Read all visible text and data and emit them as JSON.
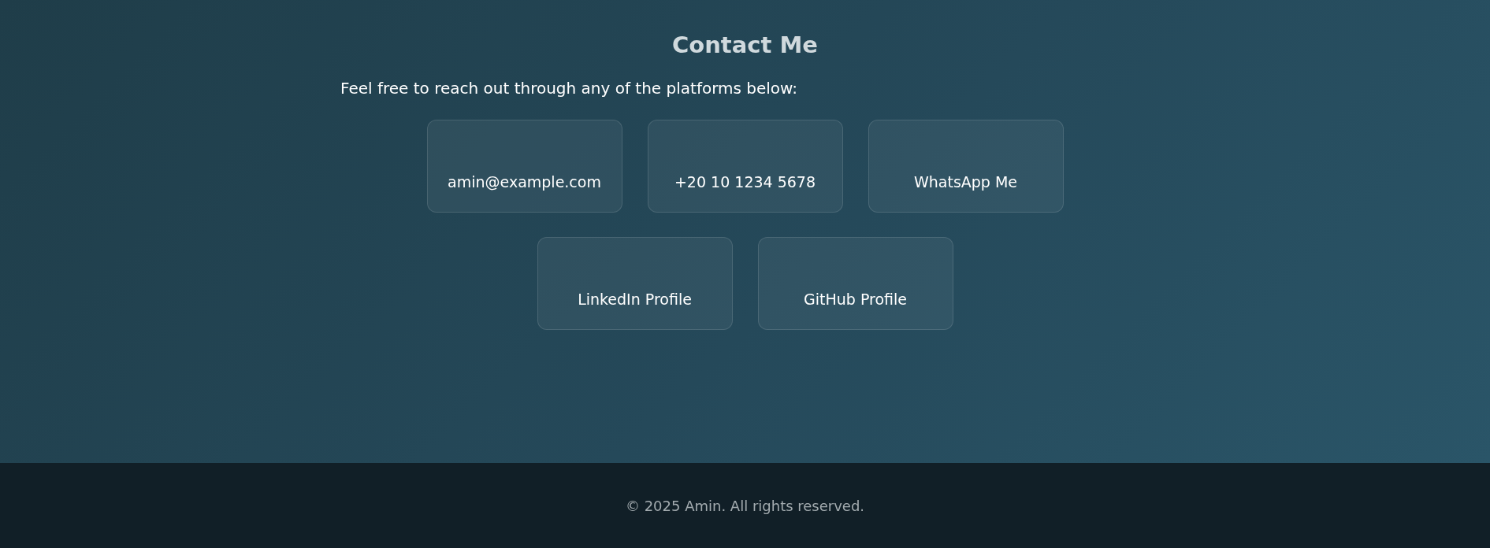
{
  "heading": "Contact Me",
  "intro": "Feel free to reach out through any of the platforms below:",
  "contacts": [
    {
      "label": "amin@example.com"
    },
    {
      "label": "+20 10 1234 5678"
    },
    {
      "label": "WhatsApp Me"
    },
    {
      "label": "LinkedIn Profile"
    },
    {
      "label": "GitHub Profile"
    }
  ],
  "footer": "© 2025 Amin. All rights reserved."
}
